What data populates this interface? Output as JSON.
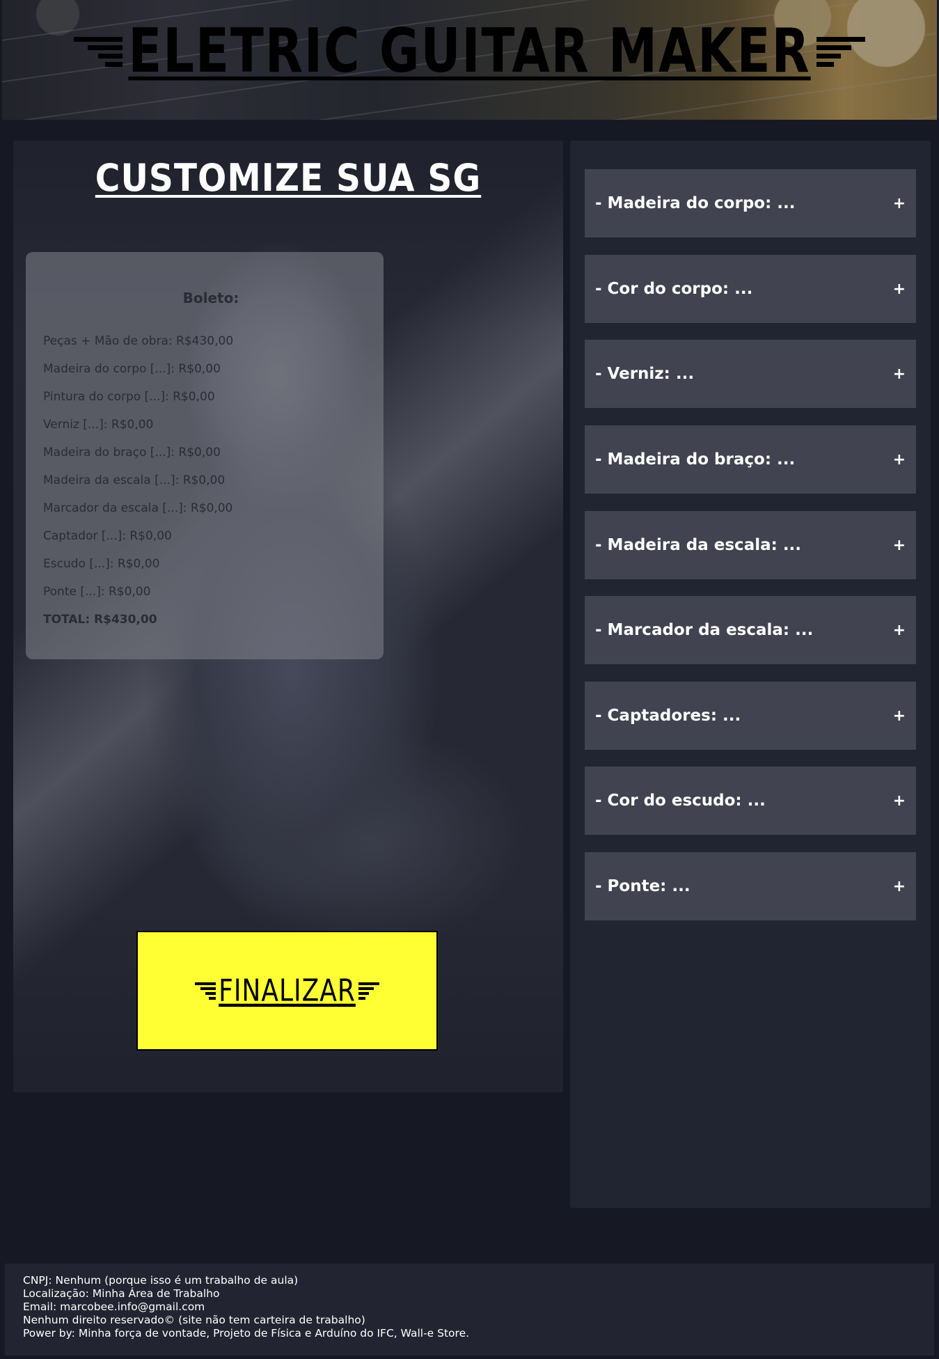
{
  "header": {
    "logo_text": "ELETRIC GUITAR MAKER"
  },
  "customize": {
    "title": "CUSTOMIZE SUA SG"
  },
  "boleto": {
    "title": "Boleto:",
    "lines": [
      "Peças + Mão de obra: R$430,00",
      "Madeira do corpo [...]: R$0,00",
      "Pintura do corpo [...]: R$0,00",
      "Verniz [...]: R$0,00",
      "Madeira do braço [...]: R$0,00",
      "Madeira da escala [...]: R$0,00",
      "Marcador da escala [...]: R$0,00",
      "Captador [...]: R$0,00",
      "Escudo [...]: R$0,00",
      "Ponte [...]: R$0,00"
    ],
    "total": "TOTAL: R$430,00"
  },
  "finalizar": {
    "label": "FINALIZAR"
  },
  "options": [
    {
      "label": "- Madeira do corpo: ...",
      "toggle": "+"
    },
    {
      "label": "- Cor do corpo: ...",
      "toggle": "+"
    },
    {
      "label": "- Verniz: ...",
      "toggle": "+"
    },
    {
      "label": "- Madeira do braço: ...",
      "toggle": "+"
    },
    {
      "label": "- Madeira da escala: ...",
      "toggle": "+"
    },
    {
      "label": "- Marcador da escala: ...",
      "toggle": "+"
    },
    {
      "label": "- Captadores: ...",
      "toggle": "+"
    },
    {
      "label": "- Cor do escudo: ...",
      "toggle": "+"
    },
    {
      "label": "- Ponte: ...",
      "toggle": "+"
    }
  ],
  "footer": {
    "lines": [
      "CNPJ: Nenhum (porque isso é um trabalho de aula)",
      "Localização: Minha Área de Trabalho",
      "Email: marcobee.info@gmail.com",
      "Nenhum direito reservado© (site não tem carteira de trabalho)",
      "Power by: Minha força de vontade, Projeto de Física e Arduíno do IFC, Wall-e Store."
    ]
  },
  "colors": {
    "page_bg": "#161923",
    "panel_bg": "#212431",
    "option_bg": "#414350",
    "button_bg": "#ffff33"
  }
}
